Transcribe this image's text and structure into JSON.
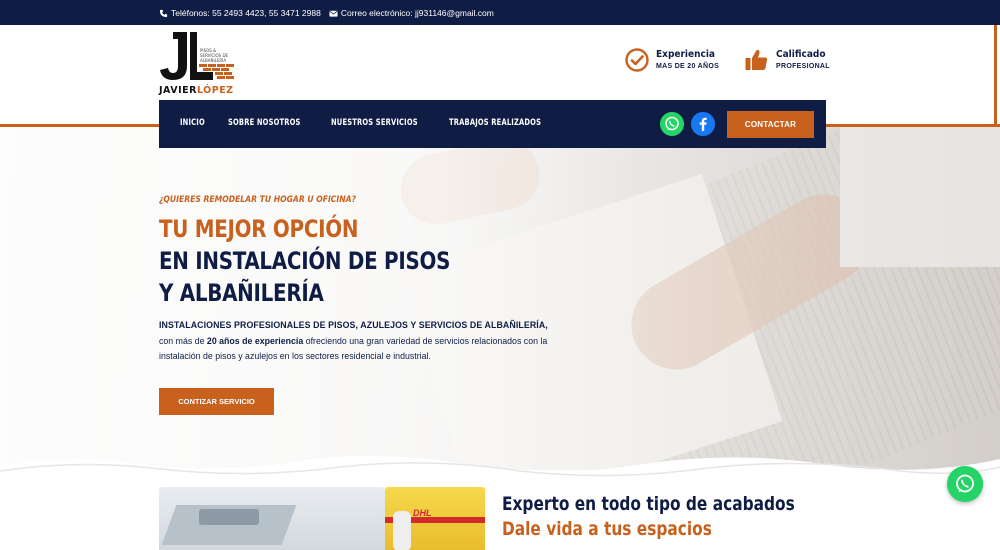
{
  "topbar": {
    "phones": "Teléfonos: 55 2493 4423, 55 3471 2988",
    "email": "Correo electrónico: jj931146@gmail.com"
  },
  "logo": {
    "letters": "JL",
    "tagline_1": "PISOS &",
    "tagline_2": "SERVICIOS DE",
    "tagline_3": "ALBAÑILERÍA",
    "name_first": "JAVIER",
    "name_last": "LÓPEZ"
  },
  "features": [
    {
      "title": "Experiencia",
      "subtitle": "MAS DE 20 AÑOS",
      "icon": "check-circle-icon"
    },
    {
      "title": "Calificado",
      "subtitle": "PROFESIONAL",
      "icon": "thumbs-up-icon"
    }
  ],
  "nav": {
    "items": [
      "INICIO",
      "SOBRE NOSOTROS",
      "NUESTROS SERVICIOS",
      "TRABAJOS REALIZADOS"
    ],
    "cta": "CONTACTAR",
    "social": [
      "whatsapp-icon",
      "facebook-icon"
    ]
  },
  "hero": {
    "kicker": "¿QUIERES REMODELAR TU HOGAR U OFICINA?",
    "line1": "TU MEJOR OPCIÓN",
    "line2": "EN INSTALACIÓN DE PISOS",
    "line3": "Y ALBAÑILERÍA",
    "desc_caps": "INSTALACIONES PROFESIONALES DE PISOS, AZULEJOS Y SERVICIOS DE ALBAÑILERÍA,",
    "desc_pre": "con más de ",
    "desc_bold": "20 años de experiencia",
    "desc_post": " ofreciendo una gran variedad de servicios relacionados con la instalación de pisos y azulejos en los sectores residencial e industrial.",
    "button": "CONTIZAR SERVICIO"
  },
  "section": {
    "title_1": "Experto en todo tipo de acabados",
    "title_2": "Dale vida a tus espacios",
    "photo_label": "DHL"
  },
  "colors": {
    "navy": "#0f1d45",
    "orange": "#c8601e",
    "whatsapp": "#25d366",
    "facebook": "#1877f2"
  }
}
